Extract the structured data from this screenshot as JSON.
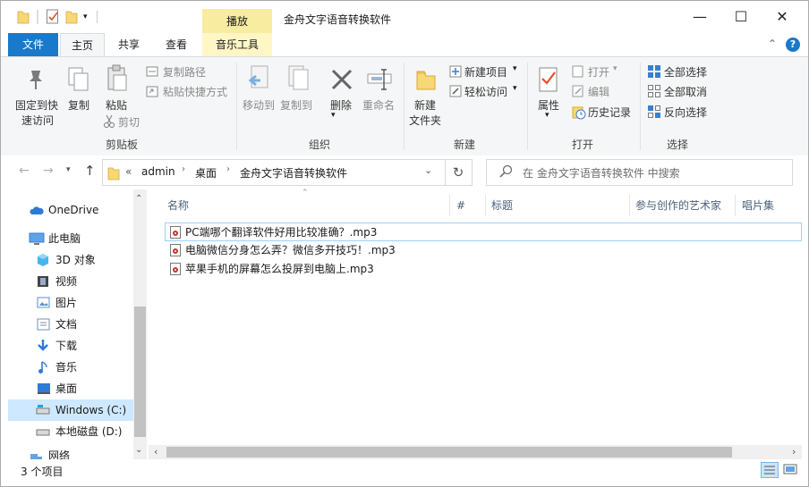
{
  "window": {
    "title": "金舟文字语音转换软件",
    "context_tab": "播放",
    "controls": {
      "minimize": "—",
      "maximize": "☐",
      "close": "✕"
    }
  },
  "ribbon_tabs": {
    "file": "文件",
    "home": "主页",
    "share": "共享",
    "view": "查看",
    "music_tools": "音乐工具"
  },
  "ribbon": {
    "clipboard": {
      "pin_line1": "固定到快",
      "pin_line2": "速访问",
      "copy": "复制",
      "paste": "粘贴",
      "copy_path": "复制路径",
      "paste_shortcut": "粘贴快捷方式",
      "cut": "剪切",
      "label": "剪贴板"
    },
    "organize": {
      "move_to": "移动到",
      "copy_to": "复制到",
      "delete": "删除",
      "rename": "重命名",
      "label": "组织"
    },
    "new": {
      "new_folder_line1": "新建",
      "new_folder_line2": "文件夹",
      "new_item": "新建项目",
      "easy_access": "轻松访问",
      "label": "新建"
    },
    "open": {
      "properties": "属性",
      "open": "打开",
      "edit": "编辑",
      "history": "历史记录",
      "label": "打开"
    },
    "select": {
      "select_all": "全部选择",
      "select_none": "全部取消",
      "invert": "反向选择",
      "label": "选择"
    }
  },
  "address": {
    "overflow": "«",
    "crumbs": [
      "admin",
      "桌面",
      "金舟文字语音转换软件"
    ],
    "search_placeholder": "在 金舟文字语音转换软件 中搜索"
  },
  "nav": {
    "items": [
      {
        "label": "OneDrive",
        "icon": "cloud-icon"
      },
      {
        "label": "此电脑",
        "icon": "computer-icon"
      },
      {
        "label": "3D 对象",
        "icon": "cube-icon"
      },
      {
        "label": "视频",
        "icon": "film-icon"
      },
      {
        "label": "图片",
        "icon": "picture-icon"
      },
      {
        "label": "文档",
        "icon": "document-icon"
      },
      {
        "label": "下载",
        "icon": "download-icon"
      },
      {
        "label": "音乐",
        "icon": "music-icon"
      },
      {
        "label": "桌面",
        "icon": "desktop-icon"
      },
      {
        "label": "Windows (C:)",
        "icon": "drive-icon"
      },
      {
        "label": "本地磁盘 (D:)",
        "icon": "drive-icon"
      },
      {
        "label": "网络",
        "icon": "network-icon"
      }
    ]
  },
  "columns": {
    "name": "名称",
    "number": "#",
    "title": "标题",
    "artists": "参与创作的艺术家",
    "album": "唱片集"
  },
  "files": [
    "PC端哪个翻译软件好用比较准确？.mp3",
    "电脑微信分身怎么弄？微信多开技巧！.mp3",
    "苹果手机的屏幕怎么投屏到电脑上.mp3"
  ],
  "status": {
    "count": "3 个项目"
  }
}
